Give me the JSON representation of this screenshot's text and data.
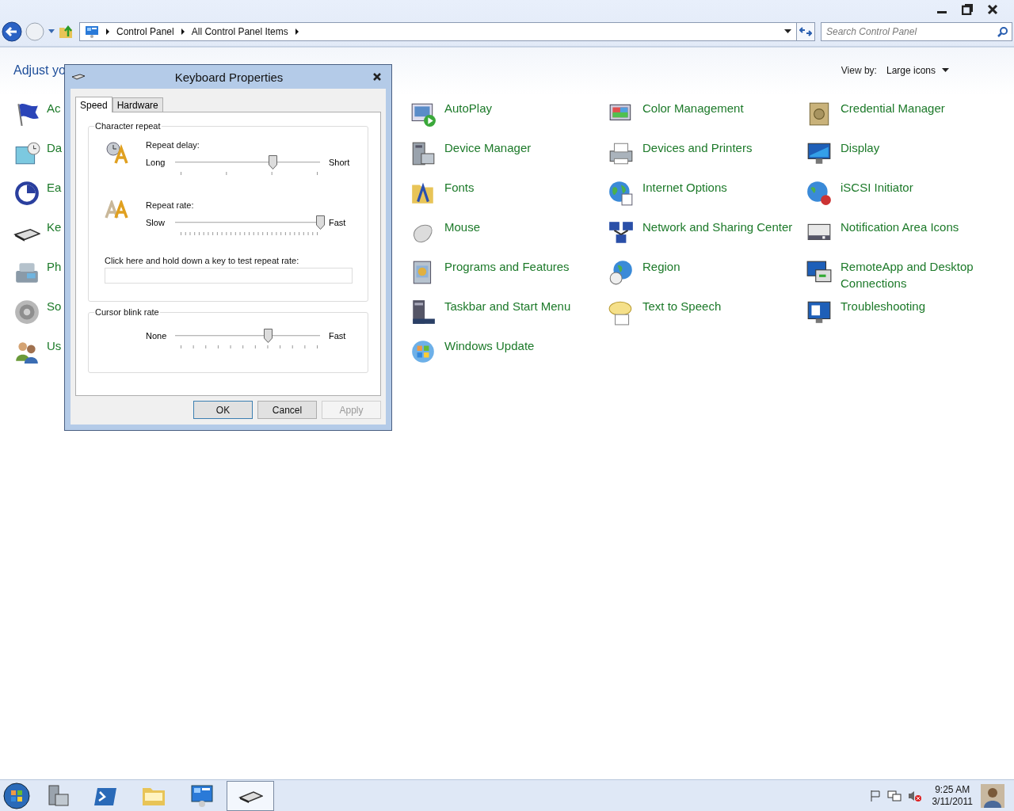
{
  "address_bar": {
    "breadcrumbs": [
      "Control Panel",
      "All Control Panel Items"
    ]
  },
  "search": {
    "placeholder": "Search Control Panel"
  },
  "heading": "Adjust yo",
  "view_by": {
    "label": "View by:",
    "value": "Large icons"
  },
  "columns": [
    [
      "Ac",
      "Da",
      "Ea",
      "Ke",
      "Ph",
      "So",
      "Us"
    ],
    [
      "AutoPlay",
      "Device Manager",
      "Fonts",
      "Mouse",
      "Programs and Features",
      "Taskbar and Start Menu",
      "Windows Update"
    ],
    [
      "Color Management",
      "Devices and Printers",
      "Internet Options",
      "Network and Sharing Center",
      "Region",
      "Text to Speech"
    ],
    [
      "Credential Manager",
      "Display",
      "iSCSI Initiator",
      "Notification Area Icons",
      "RemoteApp and Desktop Connections",
      "Troubleshooting"
    ]
  ],
  "dialog": {
    "title": "Keyboard Properties",
    "tabs": [
      {
        "label": "Speed",
        "selected": true
      },
      {
        "label": "Hardware",
        "selected": false
      }
    ],
    "groups": [
      {
        "title": "Character repeat",
        "rows": [
          {
            "kind": "slider",
            "label": "Repeat delay:",
            "min_label": "Long",
            "max_label": "Short",
            "level": 0.67
          },
          {
            "kind": "slider",
            "label": "Repeat rate:",
            "min_label": "Slow",
            "max_label": "Fast",
            "level": 1.0
          },
          {
            "kind": "test",
            "label": "Click here and hold down a key to test repeat rate:"
          }
        ]
      },
      {
        "title": "Cursor blink rate",
        "rows": [
          {
            "kind": "slider",
            "min_label": "None",
            "max_label": "Fast",
            "level": 0.64
          }
        ]
      }
    ],
    "buttons": [
      {
        "label": "OK",
        "default": true,
        "disabled": false
      },
      {
        "label": "Cancel",
        "default": false,
        "disabled": false
      },
      {
        "label": "Apply",
        "default": false,
        "disabled": true
      }
    ]
  },
  "taskbar": {
    "apps": [
      {
        "selected": false
      },
      {
        "selected": false
      },
      {
        "selected": false
      },
      {
        "selected": false
      },
      {
        "selected": true
      }
    ],
    "clock": {
      "time": "9:25 AM",
      "date": "3/11/2011"
    }
  }
}
